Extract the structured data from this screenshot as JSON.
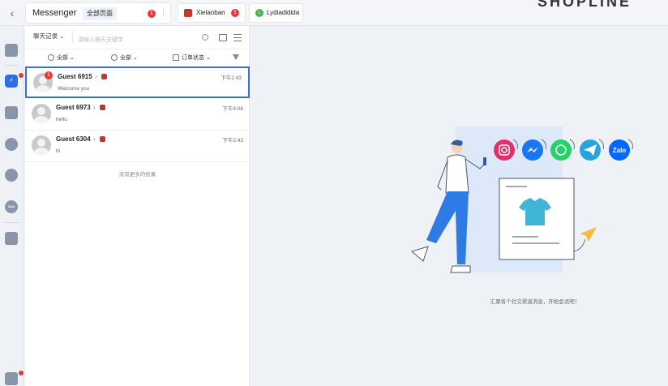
{
  "topbar": {
    "back_label": "‹",
    "main_tab": {
      "title": "Messenger",
      "sub": "全部页面",
      "badge": "1",
      "more": "⋮"
    },
    "accounts": [
      {
        "name": "Xielaoban",
        "badge": "1"
      },
      {
        "name": "Lydiadidida",
        "avatar_letter": "L"
      }
    ],
    "brand_partial": "SHOPLINE"
  },
  "panel": {
    "scope_label": "聊天记录",
    "search_placeholder": "请输入聊天关键字",
    "filters": [
      {
        "label": "全部"
      },
      {
        "label": "全部"
      },
      {
        "label": "订单状态"
      }
    ],
    "conversations": [
      {
        "name": "Guest 6915",
        "time": "下午2:43",
        "message": "Welcome you",
        "badge": "1"
      },
      {
        "name": "Guest 6973",
        "time": "下午4:06",
        "message": "hello"
      },
      {
        "name": "Guest 6304",
        "time": "下午2:43",
        "message": "hi"
      }
    ],
    "no_more": "没有更多的结果"
  },
  "main": {
    "empty_text": "汇聚各个社交渠道消息，开始会话吧！",
    "channels": [
      "instagram-icon",
      "messenger-icon",
      "whatsapp-icon",
      "telegram-icon",
      "zalo-icon"
    ],
    "zalo_label": "Zalo",
    "colors": {
      "accent": "#3a6fd8",
      "instagram": "#e1306c",
      "messenger": "#1877f2",
      "whatsapp": "#25d366",
      "telegram": "#2aa3dd",
      "zalo": "#0068ff"
    }
  }
}
